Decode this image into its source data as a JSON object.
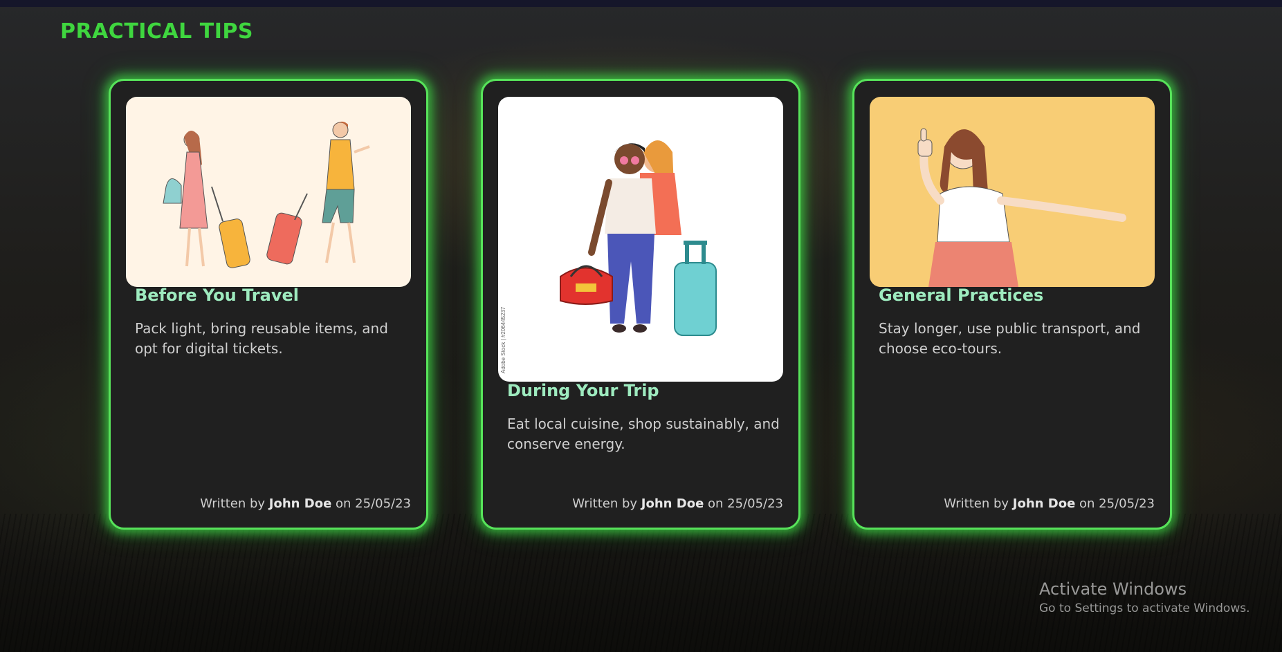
{
  "page": {
    "title": "PRACTICAL TIPS"
  },
  "cards": [
    {
      "title": "Before You Travel",
      "body": "Pack light, bring reusable items, and opt for digital tickets.",
      "byline": {
        "prefix": "Written by",
        "author": "John Doe",
        "date": "on 25/05/23"
      },
      "image_bg": "#fff4e6"
    },
    {
      "title": "During Your Trip",
      "body": "Eat local cuisine, shop sustainably, and conserve energy.",
      "byline": {
        "prefix": "Written by",
        "author": "John Doe",
        "date": "on 25/05/23"
      },
      "image_bg": "#ffffff",
      "image_watermark": "Adobe Stock | #206445237"
    },
    {
      "title": "General Practices",
      "body": "Stay longer, use public transport, and choose eco-tours.",
      "byline": {
        "prefix": "Written by",
        "author": "John Doe",
        "date": "on 25/05/23"
      },
      "image_bg": "#f8cd75"
    }
  ],
  "activate_windows": {
    "title": "Activate Windows",
    "subtitle": "Go to Settings to activate Windows."
  },
  "colors": {
    "title": "#3fd63f",
    "card_glow": "#57e35a",
    "card_title": "#9eebbf",
    "card_bg": "#202020"
  }
}
